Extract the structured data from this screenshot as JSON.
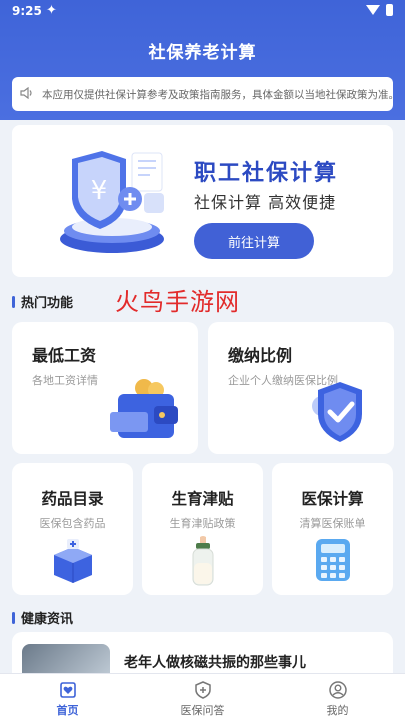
{
  "status_bar": {
    "time": "9:25"
  },
  "app": {
    "title": "社保养老计算"
  },
  "notice": {
    "text": "本应用仅提供社保计算参考及政策指南服务，具体金额以当地社保政策为准。"
  },
  "hero": {
    "title": "职工社保计算",
    "subtitle": "社保计算  高效便捷",
    "button_label": "前往计算"
  },
  "hot_section": {
    "title": "热门功能"
  },
  "watermark": {
    "text": "火鸟手游网"
  },
  "features_large": [
    {
      "title": "最低工资",
      "subtitle": "各地工资详情",
      "icon": "wallet-icon"
    },
    {
      "title": "缴纳比例",
      "subtitle": "企业个人缴纳医保比例",
      "icon": "shield-check-icon"
    }
  ],
  "features_small": [
    {
      "title": "药品目录",
      "subtitle": "医保包含药品",
      "icon": "medicine-box-icon"
    },
    {
      "title": "生育津贴",
      "subtitle": "生育津贴政策",
      "icon": "baby-bottle-icon"
    },
    {
      "title": "医保计算",
      "subtitle": "清算医保账单",
      "icon": "calculator-icon"
    }
  ],
  "health_section": {
    "title": "健康资讯"
  },
  "news": [
    {
      "title": "老年人做核磁共振的那些事儿"
    }
  ],
  "tabs": [
    {
      "label": "首页",
      "icon": "home-heart-icon",
      "active": true
    },
    {
      "label": "医保问答",
      "icon": "shield-plus-icon",
      "active": false
    },
    {
      "label": "我的",
      "icon": "user-icon",
      "active": false
    }
  ],
  "colors": {
    "primary": "#3f64d8",
    "accent_red": "#e22b2b",
    "background": "#eef2f8"
  }
}
